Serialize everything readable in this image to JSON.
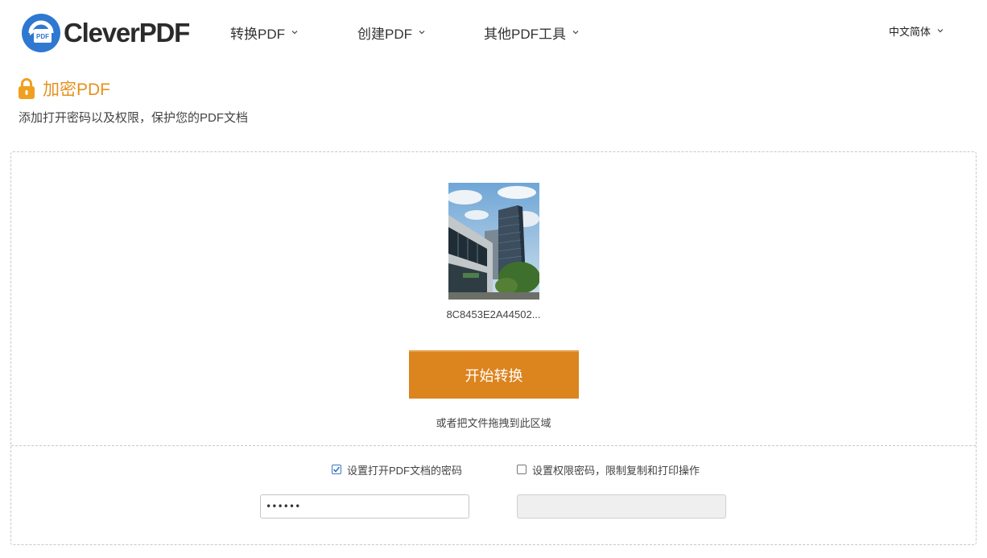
{
  "brand": {
    "name": "CleverPDF",
    "logo_badge": "PDF",
    "accent_blue": "#2f78d2",
    "accent_orange": "#e5911f"
  },
  "nav": [
    {
      "label": "转换PDF"
    },
    {
      "label": "创建PDF"
    },
    {
      "label": "其他PDF工具"
    }
  ],
  "language": {
    "label": "中文简体"
  },
  "page": {
    "title": "加密PDF",
    "subtitle": "添加打开密码以及权限，保护您的PDF文档"
  },
  "upload": {
    "file_name": "8C8453E2A44502...",
    "start_button": "开始转换",
    "drag_hint": "或者把文件拖拽到此区域"
  },
  "options": {
    "open_password": {
      "label": "设置打开PDF文档的密码",
      "checked": true,
      "value": "••••••"
    },
    "permission_password": {
      "label": "设置权限密码，限制复制和打印操作",
      "checked": false,
      "value": ""
    }
  },
  "colors": {
    "button": "#dc841e",
    "title": "#e5911f"
  }
}
